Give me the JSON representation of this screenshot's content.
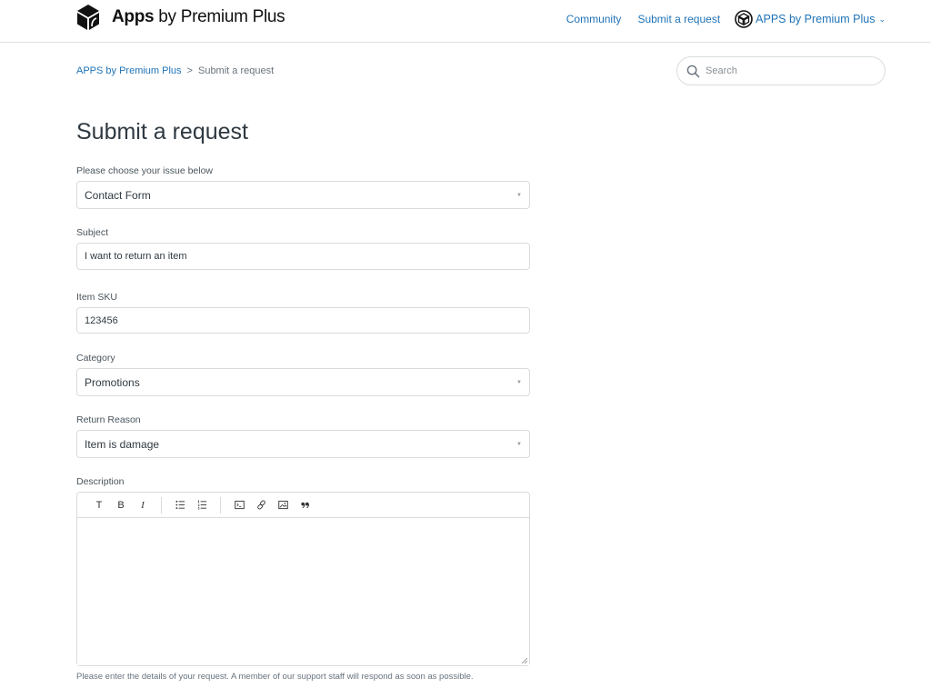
{
  "header": {
    "brand_bold": "Apps",
    "brand_rest": " by Premium Plus",
    "nav": [
      {
        "label": "Community"
      },
      {
        "label": "Submit a request"
      }
    ],
    "user_menu_label": "APPS by Premium Plus",
    "user_menu_chevron": "⌄"
  },
  "breadcrumb": {
    "items": [
      {
        "label": "APPS by Premium Plus"
      },
      {
        "label": "Submit a request"
      }
    ],
    "separator": ">"
  },
  "search": {
    "placeholder": "Search",
    "value": ""
  },
  "page": {
    "title": "Submit a request"
  },
  "form": {
    "issue": {
      "label": "Please choose your issue below",
      "value": "Contact Form"
    },
    "subject": {
      "label": "Subject",
      "value": "I want to return an item"
    },
    "sku": {
      "label": "Item SKU",
      "value": "123456"
    },
    "category": {
      "label": "Category",
      "value": "Promotions"
    },
    "return_reason": {
      "label": "Return Reason",
      "value": "Item is damage"
    },
    "description": {
      "label": "Description",
      "value": "",
      "hint": "Please enter the details of your request. A member of our support staff will respond as soon as possible.",
      "toolbar": {
        "text": "T",
        "bold": "B",
        "italic": "I"
      }
    },
    "caret": "▼"
  },
  "colors": {
    "link": "#1f73b7",
    "text": "#2f3941",
    "border": "#d8dcde"
  }
}
